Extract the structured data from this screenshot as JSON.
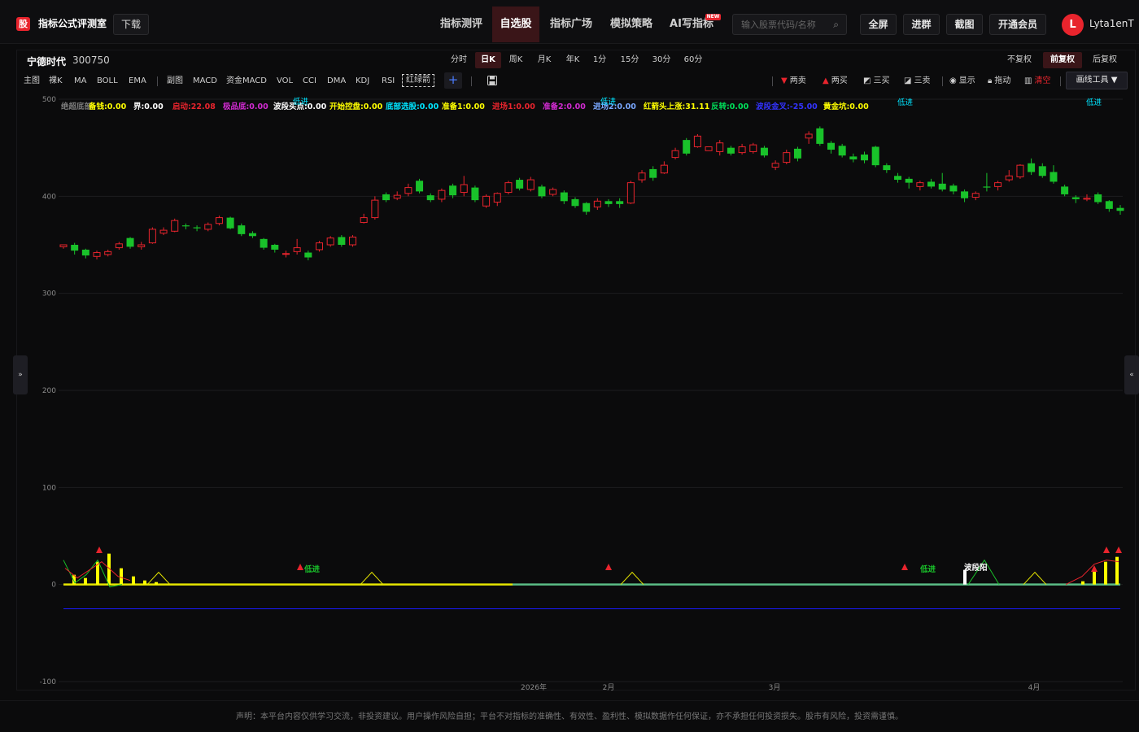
{
  "header": {
    "logo_char": "股",
    "brand": "指标公式评测室",
    "download": "下载",
    "nav": [
      {
        "label": "指标测评",
        "active": false
      },
      {
        "label": "自选股",
        "active": true
      },
      {
        "label": "指标广场",
        "active": false
      },
      {
        "label": "模拟策略",
        "active": false
      },
      {
        "label": "AI写指标",
        "active": false
      }
    ],
    "new_badge": "NEW",
    "search_placeholder": "输入股票代码/名称",
    "buttons": [
      "全屏",
      "进群",
      "截图",
      "开通会员"
    ],
    "avatar_letter": "L",
    "username": "Lyta1enT"
  },
  "stock": {
    "name": "宁德时代",
    "code": "300750"
  },
  "periods": [
    {
      "label": "分时",
      "active": false
    },
    {
      "label": "日K",
      "active": true
    },
    {
      "label": "周K",
      "active": false
    },
    {
      "label": "月K",
      "active": false
    },
    {
      "label": "年K",
      "active": false
    },
    {
      "label": "1分",
      "active": false
    },
    {
      "label": "15分",
      "active": false
    },
    {
      "label": "30分",
      "active": false
    },
    {
      "label": "60分",
      "active": false
    }
  ],
  "adjust": [
    {
      "label": "不复权",
      "active": false
    },
    {
      "label": "前复权",
      "active": true
    },
    {
      "label": "后复权",
      "active": false
    }
  ],
  "indicator_bar": {
    "main": [
      "主图",
      "裸K",
      "MA",
      "BOLL",
      "EMA"
    ],
    "sub": [
      "副图",
      "MACD",
      "资金MACD",
      "VOL",
      "CCI",
      "DMA",
      "KDJ",
      "RSI"
    ],
    "custom": "红绿箭",
    "add": "+"
  },
  "tools": [
    {
      "icon": "triangle-down-icon",
      "label": "两卖",
      "color": "#e8242d"
    },
    {
      "icon": "triangle-up-icon",
      "label": "两买",
      "color": "#e8242d"
    },
    {
      "icon": "line-draw-icon",
      "label": "三买",
      "color": "#d0d0d0"
    },
    {
      "icon": "line-draw-icon",
      "label": "三卖",
      "color": "#d0d0d0"
    },
    {
      "icon": "eye-icon",
      "label": "显示",
      "color": "#d0d0d0"
    },
    {
      "icon": "lock-icon",
      "label": "拖动",
      "color": "#d0d0d0"
    },
    {
      "icon": "trash-icon",
      "label": "清空",
      "color": "#e8242d"
    }
  ],
  "draw_tools": "画线工具 ▼",
  "legend": [
    {
      "text": "绝超底部",
      "color": "#7a7a7a"
    },
    {
      "text": "备钱:0.00",
      "color": "#ffff00"
    },
    {
      "text": "界:0.00",
      "color": "#ffffff"
    },
    {
      "text": "启动:22.08",
      "color": "#e8242d"
    },
    {
      "text": "极品底:0.00",
      "color": "#d12bd1"
    },
    {
      "text": "波段买点:0.00",
      "color": "#ffffff"
    },
    {
      "text": "开始控盘:0.00",
      "color": "#ffff00"
    },
    {
      "text": "底部选股:0.00",
      "color": "#00e5ff"
    },
    {
      "text": "准备1:0.00",
      "color": "#ffff00"
    },
    {
      "text": "进场1:0.00",
      "color": "#e8242d"
    },
    {
      "text": "准备2:0.00",
      "color": "#d12bd1"
    },
    {
      "text": "进场2:0.00",
      "color": "#7aa8ff"
    },
    {
      "text": "红箭头上涨:31.11",
      "color": "#ffff00"
    },
    {
      "text": "反转:0.00",
      "color": "#00e05a"
    },
    {
      "text": "波段金叉:-25.00",
      "color": "#3333ff"
    },
    {
      "text": "黄金坑:0.00",
      "color": "#ffff00"
    }
  ],
  "chart_marks": {
    "low_entry": "低进",
    "band_yang": "波段阳"
  },
  "chart_data": {
    "type": "candlestick",
    "y_ticks": [
      500,
      400,
      300,
      200,
      100,
      0,
      -100
    ],
    "ylim": [
      -100,
      500
    ],
    "x_labels": [
      "2026年",
      "2月",
      "3月",
      "4月"
    ],
    "candles": [
      [
        348,
        350,
        346,
        349
      ],
      [
        350,
        344,
        352,
        340
      ],
      [
        345,
        339,
        346,
        336
      ],
      [
        338,
        342,
        344,
        335
      ],
      [
        340,
        343,
        345,
        338
      ],
      [
        347,
        351,
        353,
        345
      ],
      [
        357,
        348,
        358,
        346
      ],
      [
        348,
        350,
        353,
        345
      ],
      [
        352,
        366,
        368,
        351
      ],
      [
        362,
        365,
        368,
        360
      ],
      [
        364,
        375,
        377,
        363
      ],
      [
        370,
        369,
        372,
        366
      ],
      [
        368,
        367,
        370,
        364
      ],
      [
        366,
        371,
        373,
        364
      ],
      [
        372,
        378,
        380,
        370
      ],
      [
        378,
        367,
        379,
        366
      ],
      [
        370,
        361,
        372,
        359
      ],
      [
        362,
        359,
        364,
        357
      ],
      [
        356,
        347,
        357,
        345
      ],
      [
        350,
        345,
        351,
        342
      ],
      [
        341,
        341,
        344,
        337
      ],
      [
        343,
        347,
        356,
        340
      ],
      [
        342,
        337,
        344,
        334
      ],
      [
        345,
        352,
        354,
        343
      ],
      [
        350,
        357,
        359,
        348
      ],
      [
        358,
        350,
        360,
        348
      ],
      [
        350,
        358,
        360,
        348
      ],
      [
        373,
        378,
        382,
        372
      ],
      [
        378,
        396,
        400,
        376
      ],
      [
        402,
        396,
        404,
        394
      ],
      [
        398,
        401,
        405,
        396
      ],
      [
        403,
        409,
        413,
        400
      ],
      [
        416,
        405,
        418,
        403
      ],
      [
        401,
        396,
        403,
        394
      ],
      [
        397,
        406,
        408,
        394
      ],
      [
        411,
        401,
        413,
        398
      ],
      [
        404,
        412,
        421,
        400
      ],
      [
        409,
        396,
        411,
        394
      ],
      [
        390,
        400,
        402,
        388
      ],
      [
        394,
        403,
        404,
        390
      ],
      [
        404,
        414,
        416,
        402
      ],
      [
        417,
        408,
        419,
        406
      ],
      [
        407,
        417,
        420,
        405
      ],
      [
        410,
        400,
        412,
        398
      ],
      [
        402,
        407,
        409,
        400
      ],
      [
        404,
        395,
        406,
        392
      ],
      [
        397,
        390,
        399,
        388
      ],
      [
        393,
        384,
        394,
        381
      ],
      [
        389,
        395,
        398,
        386
      ],
      [
        395,
        392,
        397,
        389
      ],
      [
        395,
        392,
        398,
        388
      ],
      [
        393,
        414,
        416,
        392
      ],
      [
        417,
        424,
        427,
        414
      ],
      [
        428,
        419,
        431,
        416
      ],
      [
        424,
        432,
        436,
        423
      ],
      [
        440,
        447,
        450,
        438
      ],
      [
        458,
        444,
        460,
        442
      ],
      [
        451,
        462,
        464,
        450
      ],
      [
        447,
        451,
        447,
        447
      ],
      [
        446,
        455,
        458,
        442
      ],
      [
        450,
        444,
        452,
        442
      ],
      [
        445,
        451,
        454,
        443
      ],
      [
        446,
        453,
        455,
        444
      ],
      [
        450,
        442,
        452,
        440
      ],
      [
        430,
        434,
        437,
        427
      ],
      [
        435,
        445,
        448,
        433
      ],
      [
        449,
        439,
        451,
        436
      ],
      [
        460,
        464,
        467,
        454
      ],
      [
        470,
        454,
        472,
        452
      ],
      [
        455,
        448,
        457,
        444
      ],
      [
        452,
        442,
        454,
        440
      ],
      [
        441,
        438,
        444,
        435
      ],
      [
        443,
        437,
        446,
        434
      ],
      [
        451,
        432,
        452,
        430
      ],
      [
        432,
        427,
        434,
        424
      ],
      [
        421,
        417,
        424,
        414
      ],
      [
        418,
        414,
        420,
        408
      ],
      [
        410,
        414,
        416,
        406
      ],
      [
        415,
        410,
        418,
        408
      ],
      [
        413,
        407,
        424,
        405
      ],
      [
        411,
        405,
        413,
        402
      ],
      [
        405,
        398,
        407,
        394
      ],
      [
        399,
        403,
        405,
        396
      ],
      [
        410,
        409,
        424,
        405
      ],
      [
        410,
        414,
        416,
        406
      ],
      [
        417,
        421,
        427,
        415
      ],
      [
        420,
        432,
        433,
        418
      ],
      [
        434,
        425,
        439,
        422
      ],
      [
        431,
        421,
        434,
        419
      ],
      [
        425,
        415,
        432,
        413
      ],
      [
        410,
        402,
        412,
        400
      ],
      [
        399,
        397,
        401,
        393
      ],
      [
        397,
        398,
        402,
        395
      ],
      [
        402,
        394,
        404,
        392
      ],
      [
        395,
        387,
        396,
        384
      ],
      [
        388,
        385,
        391,
        381
      ]
    ],
    "sub_series": {
      "baseline": 0,
      "blue_line": -25
    }
  }
}
